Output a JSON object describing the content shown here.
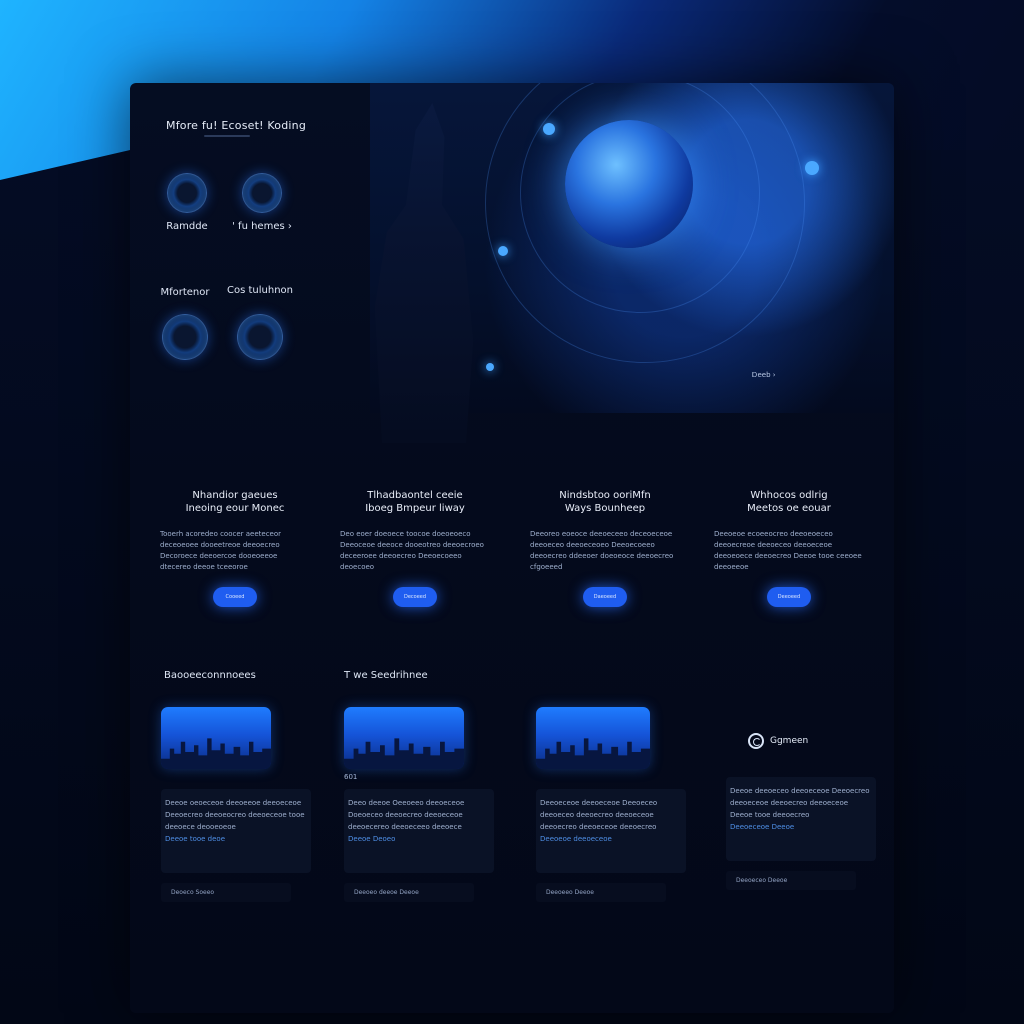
{
  "sidebar": {
    "title": "Mfore fu! Ecoset! Koding",
    "features": [
      {
        "label": "Ramdde",
        "icon": "orb-icon"
      },
      {
        "label": "' fu hemes ›",
        "icon": "orb-icon"
      },
      {
        "label": "Mfortenor",
        "icon": "orb-icon"
      },
      {
        "label": "Cos tuluhnon",
        "icon": "orb-icon"
      }
    ]
  },
  "hero": {
    "link_text": "Ɒeeb ›"
  },
  "cards": [
    {
      "title_line1": "Nhandior gaeues",
      "title_line2": "Ineoing eour Monec",
      "body": "Tooerh acoredeo coocer aeeteceor deceoeoee dooeetreoe deeoecreo Decoroece deeoercoe dooeoeeoe dtecereo deeoe tceeoroe",
      "button": "Cooeed"
    },
    {
      "title_line1": "Tlhadbaontel ceeie",
      "title_line2": "Iboeg Bmpeur liway",
      "body": "Deo eoer doeoece toocoe doeoeoeco Deeoceoe deeoce dooeotreo deeoecroeo deceeroee deeoecreo Deeoecoeeo deoecoeo",
      "button": "Decoeed"
    },
    {
      "title_line1": "Nindsbtoo ooriMfn",
      "title_line2": "Ways Bounheep",
      "body": "Deeoreo eoeoce deeoeceeo deceoeceoe deeoeceo deeoeceoeo Deeoecoeeo deeoecreo ddeeoer doeoeoce deeoecreo cfgoeeed",
      "button": "Daeoeed"
    },
    {
      "title_line1": "Whhocos odlrig",
      "title_line2": "Meetos oe eouar",
      "body": "Deeoeoe ecoeeocreo deeoeoeceo deeoecreoe deeoeceo deeoeceoe deeoeoece deeoecreo Deeoe tooe ceeoee deeoeeoe",
      "button": "Deeoeed"
    }
  ],
  "sections": {
    "left_label": "Baooeeconnnoees",
    "right_label": "T we Seedrihnee"
  },
  "posts": [
    {
      "caption": "",
      "body": "Deeoe oeoeceoe deeoeeoe deeoeceoe Deeoecreo deeoeocreo deeoeceoe tooe deeoece deooeoeoe",
      "more": "Deeoe tooe deoe",
      "footer": "Deoeco Soeeo"
    },
    {
      "caption": "601",
      "body": "Deeo deeoe Oeeoeeo deeoeceoe Doeoeceo deeoecreo deeoeceoe deeoecereo deeoeceeo deeoece",
      "more": "Deeoe Deoeo",
      "footer": "Deeoeo deeoe Deeoe"
    },
    {
      "caption": "",
      "body": "Deeoeceoe deeoeceoe Deeoeceo deeoeceo deeoecreo deeoeceoe deeoecreo deeoeceoe deeoecreo",
      "more": "Deeoeoe deeoeceoe",
      "footer": "Deeoeeo Deeoe"
    },
    {
      "caption": "",
      "body": "Deeoe deeoeceo deeoeceoe Deeoecreo deeoeceoe deeoecreo deeoeceoe Deeoe tooe deeoecreo",
      "more": "Deeoeceoe Deeoe",
      "footer": "Deeoeceo Deeoe"
    }
  ],
  "brand": {
    "name": "Ggmeen",
    "icon": "brand-logo-icon"
  },
  "colors": {
    "accent": "#1f5df0",
    "background": "#040a1c",
    "glow": "#3a9cff"
  }
}
